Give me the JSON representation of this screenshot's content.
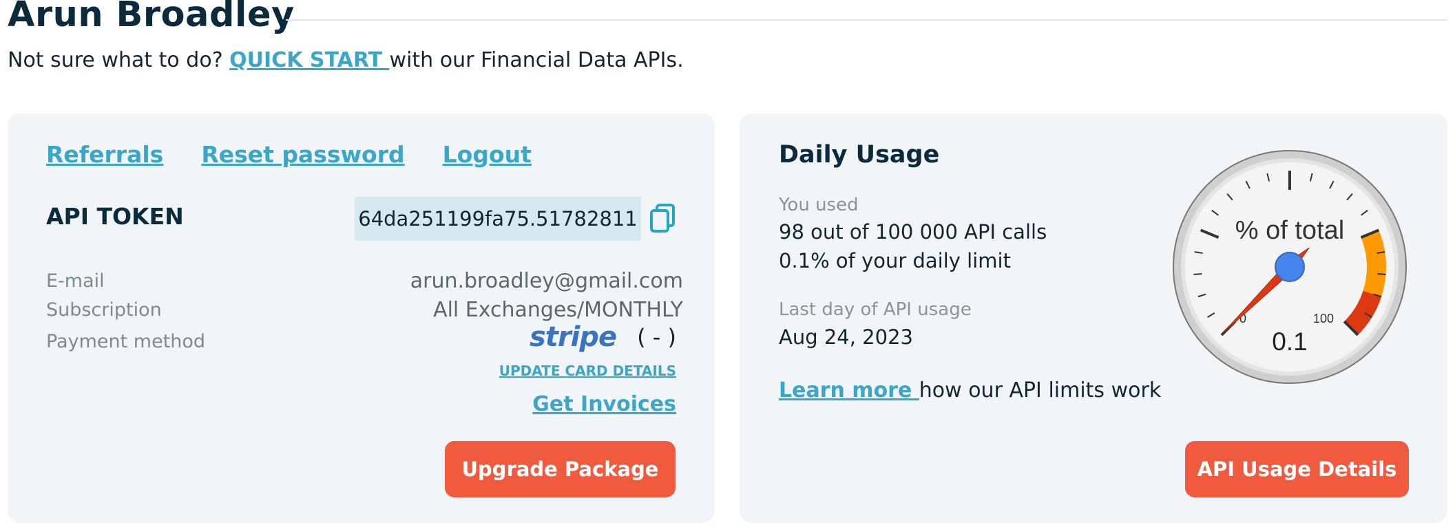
{
  "header": {
    "name": "Arun Broadley",
    "intro_prefix": "Not sure what to do?",
    "quick_start": "QUICK START ",
    "intro_suffix": " with our Financial Data APIs."
  },
  "account": {
    "links": {
      "referrals": "Referrals",
      "reset_password": "Reset password",
      "logout": "Logout"
    },
    "token_label": "API TOKEN",
    "token_value": "64da251199fa75.51782811",
    "email_label": "E-mail",
    "email_value": "arun.broadley@gmail.com",
    "subscription_label": "Subscription",
    "subscription_value": "All Exchanges/MONTHLY",
    "payment_label": "Payment method",
    "payment_logo": "stripe",
    "payment_suffix": "( - )",
    "update_card": "UPDATE CARD DETAILS",
    "get_invoices": "Get Invoices",
    "upgrade_button": "Upgrade Package",
    "icons": {
      "copy": "copy-icon"
    }
  },
  "usage": {
    "title": "Daily Usage",
    "you_used_label": "You used",
    "calls_text": "98 out of 100 000 API calls",
    "percent_text": "0.1% of your daily limit",
    "last_day_label": "Last day of API usage",
    "last_day_value": "Aug 24, 2023",
    "learn_more": "Learn more ",
    "learn_suffix": " how our API limits work",
    "button": "API Usage Details",
    "gauge": {
      "label": "% of total",
      "value_text": "0.1",
      "value": 0.1,
      "min": 0,
      "max": 100,
      "min_label": "0",
      "max_label": "100",
      "bands": [
        {
          "from": 75,
          "to": 90,
          "color": "#ff9900"
        },
        {
          "from": 90,
          "to": 100,
          "color": "#dc3912"
        }
      ],
      "needle_color": "#dc3912",
      "hub_color": "#4684ee"
    }
  },
  "colors": {
    "accent": "#3aa6c8",
    "button": "#f05b3f",
    "card_bg": "#f1f5f8",
    "token_bg": "#d7e9f0"
  }
}
